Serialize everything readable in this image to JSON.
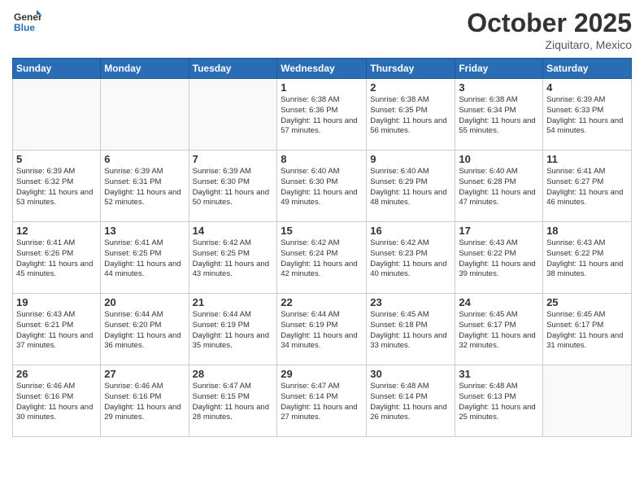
{
  "header": {
    "logo_general": "General",
    "logo_blue": "Blue",
    "month": "October 2025",
    "location": "Ziquitaro, Mexico"
  },
  "days_of_week": [
    "Sunday",
    "Monday",
    "Tuesday",
    "Wednesday",
    "Thursday",
    "Friday",
    "Saturday"
  ],
  "weeks": [
    [
      {
        "day": "",
        "info": ""
      },
      {
        "day": "",
        "info": ""
      },
      {
        "day": "",
        "info": ""
      },
      {
        "day": "1",
        "info": "Sunrise: 6:38 AM\nSunset: 6:36 PM\nDaylight: 11 hours\nand 57 minutes."
      },
      {
        "day": "2",
        "info": "Sunrise: 6:38 AM\nSunset: 6:35 PM\nDaylight: 11 hours\nand 56 minutes."
      },
      {
        "day": "3",
        "info": "Sunrise: 6:38 AM\nSunset: 6:34 PM\nDaylight: 11 hours\nand 55 minutes."
      },
      {
        "day": "4",
        "info": "Sunrise: 6:39 AM\nSunset: 6:33 PM\nDaylight: 11 hours\nand 54 minutes."
      }
    ],
    [
      {
        "day": "5",
        "info": "Sunrise: 6:39 AM\nSunset: 6:32 PM\nDaylight: 11 hours\nand 53 minutes."
      },
      {
        "day": "6",
        "info": "Sunrise: 6:39 AM\nSunset: 6:31 PM\nDaylight: 11 hours\nand 52 minutes."
      },
      {
        "day": "7",
        "info": "Sunrise: 6:39 AM\nSunset: 6:30 PM\nDaylight: 11 hours\nand 50 minutes."
      },
      {
        "day": "8",
        "info": "Sunrise: 6:40 AM\nSunset: 6:30 PM\nDaylight: 11 hours\nand 49 minutes."
      },
      {
        "day": "9",
        "info": "Sunrise: 6:40 AM\nSunset: 6:29 PM\nDaylight: 11 hours\nand 48 minutes."
      },
      {
        "day": "10",
        "info": "Sunrise: 6:40 AM\nSunset: 6:28 PM\nDaylight: 11 hours\nand 47 minutes."
      },
      {
        "day": "11",
        "info": "Sunrise: 6:41 AM\nSunset: 6:27 PM\nDaylight: 11 hours\nand 46 minutes."
      }
    ],
    [
      {
        "day": "12",
        "info": "Sunrise: 6:41 AM\nSunset: 6:26 PM\nDaylight: 11 hours\nand 45 minutes."
      },
      {
        "day": "13",
        "info": "Sunrise: 6:41 AM\nSunset: 6:25 PM\nDaylight: 11 hours\nand 44 minutes."
      },
      {
        "day": "14",
        "info": "Sunrise: 6:42 AM\nSunset: 6:25 PM\nDaylight: 11 hours\nand 43 minutes."
      },
      {
        "day": "15",
        "info": "Sunrise: 6:42 AM\nSunset: 6:24 PM\nDaylight: 11 hours\nand 42 minutes."
      },
      {
        "day": "16",
        "info": "Sunrise: 6:42 AM\nSunset: 6:23 PM\nDaylight: 11 hours\nand 40 minutes."
      },
      {
        "day": "17",
        "info": "Sunrise: 6:43 AM\nSunset: 6:22 PM\nDaylight: 11 hours\nand 39 minutes."
      },
      {
        "day": "18",
        "info": "Sunrise: 6:43 AM\nSunset: 6:22 PM\nDaylight: 11 hours\nand 38 minutes."
      }
    ],
    [
      {
        "day": "19",
        "info": "Sunrise: 6:43 AM\nSunset: 6:21 PM\nDaylight: 11 hours\nand 37 minutes."
      },
      {
        "day": "20",
        "info": "Sunrise: 6:44 AM\nSunset: 6:20 PM\nDaylight: 11 hours\nand 36 minutes."
      },
      {
        "day": "21",
        "info": "Sunrise: 6:44 AM\nSunset: 6:19 PM\nDaylight: 11 hours\nand 35 minutes."
      },
      {
        "day": "22",
        "info": "Sunrise: 6:44 AM\nSunset: 6:19 PM\nDaylight: 11 hours\nand 34 minutes."
      },
      {
        "day": "23",
        "info": "Sunrise: 6:45 AM\nSunset: 6:18 PM\nDaylight: 11 hours\nand 33 minutes."
      },
      {
        "day": "24",
        "info": "Sunrise: 6:45 AM\nSunset: 6:17 PM\nDaylight: 11 hours\nand 32 minutes."
      },
      {
        "day": "25",
        "info": "Sunrise: 6:45 AM\nSunset: 6:17 PM\nDaylight: 11 hours\nand 31 minutes."
      }
    ],
    [
      {
        "day": "26",
        "info": "Sunrise: 6:46 AM\nSunset: 6:16 PM\nDaylight: 11 hours\nand 30 minutes."
      },
      {
        "day": "27",
        "info": "Sunrise: 6:46 AM\nSunset: 6:16 PM\nDaylight: 11 hours\nand 29 minutes."
      },
      {
        "day": "28",
        "info": "Sunrise: 6:47 AM\nSunset: 6:15 PM\nDaylight: 11 hours\nand 28 minutes."
      },
      {
        "day": "29",
        "info": "Sunrise: 6:47 AM\nSunset: 6:14 PM\nDaylight: 11 hours\nand 27 minutes."
      },
      {
        "day": "30",
        "info": "Sunrise: 6:48 AM\nSunset: 6:14 PM\nDaylight: 11 hours\nand 26 minutes."
      },
      {
        "day": "31",
        "info": "Sunrise: 6:48 AM\nSunset: 6:13 PM\nDaylight: 11 hours\nand 25 minutes."
      },
      {
        "day": "",
        "info": ""
      }
    ]
  ]
}
